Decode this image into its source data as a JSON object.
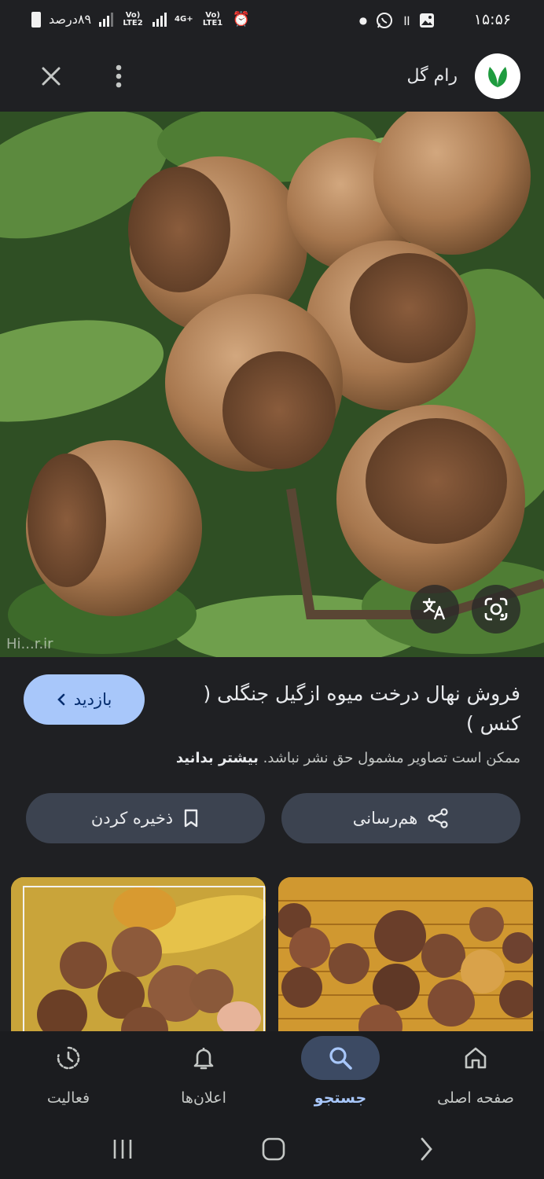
{
  "status_bar": {
    "time": "۱۵:۵۶",
    "battery_text": "۸۹درصد",
    "sim2_label": "Vo) LTE2",
    "network_label": "4G+",
    "sim1_label": "Vo) LTE1",
    "notif_count": "॥"
  },
  "header": {
    "site_name": "رام گل",
    "accent_color": "#1e9b3e"
  },
  "hero": {
    "watermark": "Hi...r.ir"
  },
  "info": {
    "title": "فروش نهال درخت میوه ازگیل جنگلی ( کنس )",
    "visit_label": "بازدید",
    "copyright_text": "ممکن است تصاویر مشمول حق نشر نباشد.",
    "learn_more": "بیشتر بدانید",
    "share_label": "هم‌رسانی",
    "save_label": "ذخیره کردن"
  },
  "bottom_nav": {
    "items": [
      {
        "label": "صفحه اصلی",
        "icon": "home-icon"
      },
      {
        "label": "جستجو",
        "icon": "search-icon"
      },
      {
        "label": "اعلان‌ها",
        "icon": "bell-icon"
      },
      {
        "label": "فعالیت",
        "icon": "activity-icon"
      }
    ],
    "active_color": "#a8c7fa"
  }
}
